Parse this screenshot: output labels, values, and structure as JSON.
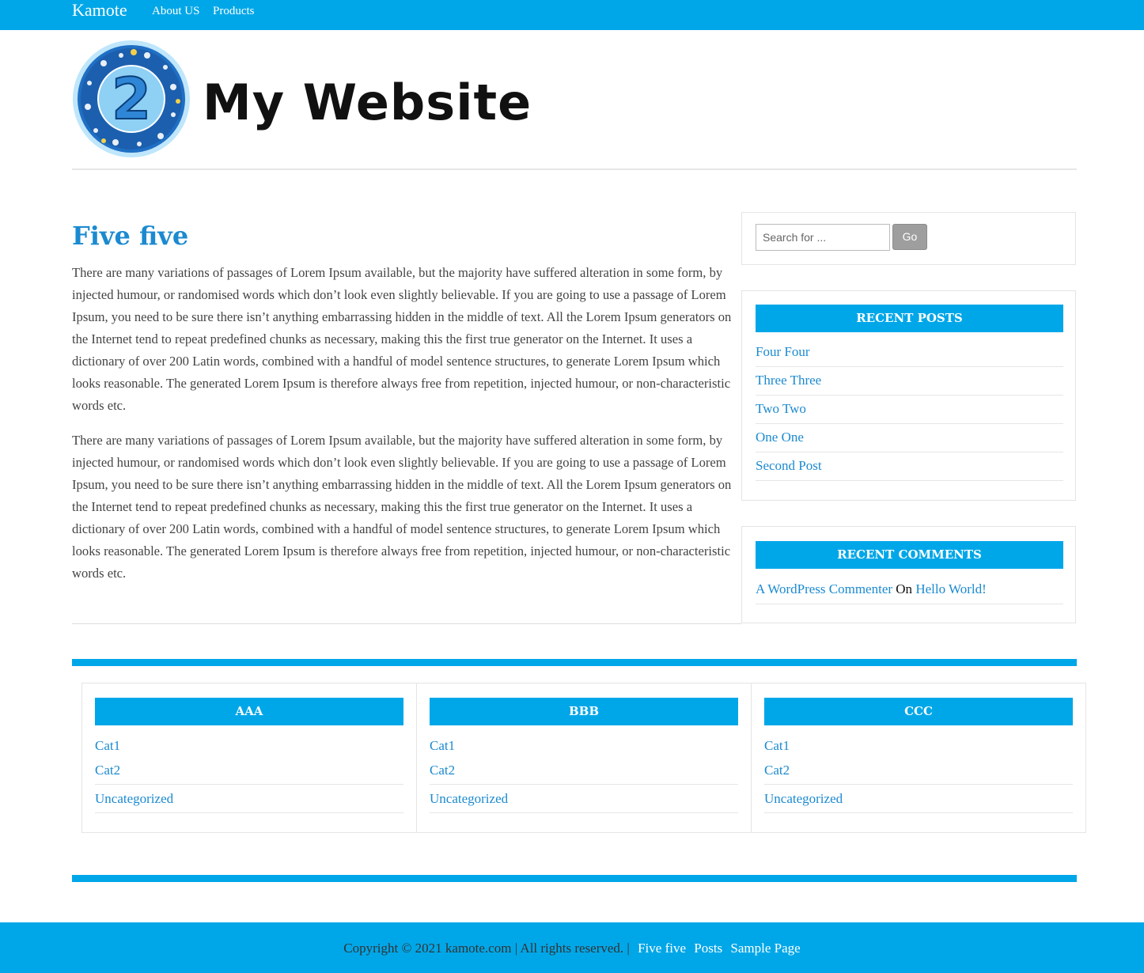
{
  "topnav": {
    "brand": "Kamote",
    "links": [
      "About US",
      "Products"
    ]
  },
  "header": {
    "site_title": "My Website",
    "logo_number": "2"
  },
  "post": {
    "title": "Five five",
    "paragraphs": [
      "There are many variations of passages of Lorem Ipsum available, but the majority have suffered alteration in some form, by injected humour, or randomised words which don’t look even slightly believable. If you are going to use a passage of Lorem Ipsum, you need to be sure there isn’t anything embarrassing hidden in the middle of text. All the Lorem Ipsum generators on the Internet tend to repeat predefined chunks as necessary, making this the first true generator on the Internet. It uses a dictionary of over 200 Latin words, combined with a handful of model sentence structures, to generate Lorem Ipsum which looks reasonable. The generated Lorem Ipsum is therefore always free from repetition, injected humour, or non-characteristic words etc.",
      "There are many variations of passages of Lorem Ipsum available, but the majority have suffered alteration in some form, by injected humour, or randomised words which don’t look even slightly believable. If you are going to use a passage of Lorem Ipsum, you need to be sure there isn’t anything embarrassing hidden in the middle of text. All the Lorem Ipsum generators on the Internet tend to repeat predefined chunks as necessary, making this the first true generator on the Internet. It uses a dictionary of over 200 Latin words, combined with a handful of model sentence structures, to generate Lorem Ipsum which looks reasonable. The generated Lorem Ipsum is therefore always free from repetition, injected humour, or non-characteristic words etc."
    ]
  },
  "sidebar": {
    "search": {
      "placeholder": "Search for ...",
      "button": "Go"
    },
    "recent_posts": {
      "title": "RECENT POSTS",
      "items": [
        "Four Four",
        "Three Three",
        "Two Two",
        "One One",
        "Second Post"
      ]
    },
    "recent_comments": {
      "title": "RECENT COMMENTS",
      "author": "A WordPress Commenter",
      "on": "On",
      "post": "Hello World!"
    }
  },
  "footer_widgets": [
    {
      "title": "AAA",
      "items": [
        "Cat1",
        "Cat2",
        "Uncategorized"
      ]
    },
    {
      "title": "BBB",
      "items": [
        "Cat1",
        "Cat2",
        "Uncategorized"
      ]
    },
    {
      "title": "CCC",
      "items": [
        "Cat1",
        "Cat2",
        "Uncategorized"
      ]
    }
  ],
  "footer": {
    "copyright": "Copyright © 2021 kamote.com | All rights reserved. |",
    "links": [
      "Five five",
      "Posts",
      "Sample Page"
    ]
  },
  "colors": {
    "accent": "#00a7e8",
    "link": "#1b8ad0"
  }
}
